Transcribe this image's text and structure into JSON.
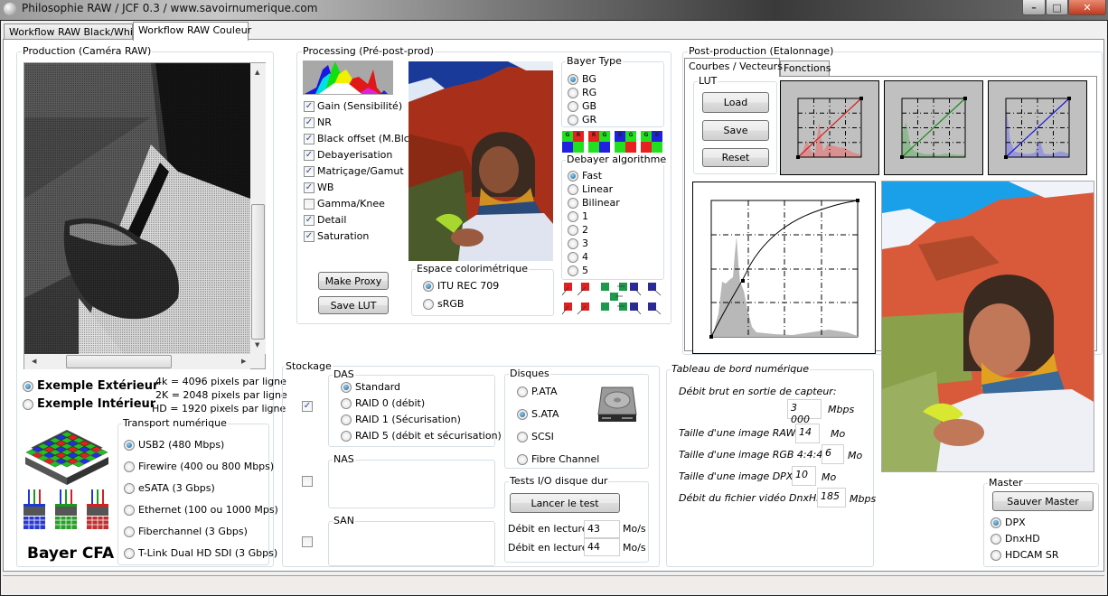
{
  "window": {
    "title": "Philosophie RAW / JCF 0.3 / www.savoirnumerique.com",
    "controls": {
      "minimize": "–",
      "maximize": "□",
      "close": "✕"
    }
  },
  "tabs": [
    {
      "label": "Workflow RAW Black/White",
      "active": false
    },
    {
      "label": "Workflow RAW Couleur",
      "active": true
    }
  ],
  "production": {
    "title": "Production (Caméra RAW)",
    "examples": [
      {
        "label": "Exemple Extérieur",
        "selected": true
      },
      {
        "label": "Exemple Intérieur",
        "selected": false
      }
    ],
    "resolutions": [
      "4k = 4096 pixels par ligne",
      "2K = 2048 pixels par ligne",
      "HD = 1920 pixels par ligne"
    ],
    "bayer_label": "Bayer CFA",
    "transport": {
      "title": "Transport numérique",
      "options": [
        {
          "label": "USB2 (480 Mbps)",
          "selected": true
        },
        {
          "label": "Firewire (400 ou 800 Mbps)",
          "selected": false
        },
        {
          "label": "eSATA (3 Gbps)",
          "selected": false
        },
        {
          "label": "Ethernet (100 ou 1000 Mps)",
          "selected": false
        },
        {
          "label": "Fiberchannel (3 Gbps)",
          "selected": false
        },
        {
          "label": "T-Link Dual HD SDI (3 Gbps)",
          "selected": false
        }
      ]
    }
  },
  "processing": {
    "title": "Processing (Pré-post-prod)",
    "checks": [
      {
        "label": "Gain (Sensibilité)",
        "checked": true
      },
      {
        "label": "NR",
        "checked": true
      },
      {
        "label": "Black offset (M.Blck)",
        "checked": true
      },
      {
        "label": "Debayerisation",
        "checked": true
      },
      {
        "label": "Matriçage/Gamut",
        "checked": true
      },
      {
        "label": "WB",
        "checked": true
      },
      {
        "label": "Gamma/Knee",
        "checked": false
      },
      {
        "label": "Detail",
        "checked": true
      },
      {
        "label": "Saturation",
        "checked": true
      }
    ],
    "make_proxy": "Make Proxy",
    "save_lut": "Save LUT",
    "colorspace": {
      "title": "Espace colorimétrique",
      "options": [
        {
          "label": "ITU REC 709",
          "selected": true
        },
        {
          "label": "sRGB",
          "selected": false
        }
      ]
    },
    "bayer_type": {
      "title": "Bayer Type",
      "options": [
        {
          "label": "BG",
          "selected": true
        },
        {
          "label": "RG",
          "selected": false
        },
        {
          "label": "GB",
          "selected": false
        },
        {
          "label": "GR",
          "selected": false
        }
      ],
      "patterns": [
        [
          "G",
          "R",
          "B",
          "G"
        ],
        [
          "R",
          "G",
          "G",
          "B"
        ],
        [
          "B",
          "G",
          "G",
          "R"
        ],
        [
          "G",
          "B",
          "R",
          "G"
        ]
      ]
    },
    "debayer": {
      "title": "Debayer algorithme",
      "options": [
        {
          "label": "Fast",
          "selected": true
        },
        {
          "label": "Linear",
          "selected": false
        },
        {
          "label": "Bilinear",
          "selected": false
        },
        {
          "label": "1",
          "selected": false
        },
        {
          "label": "2",
          "selected": false
        },
        {
          "label": "3",
          "selected": false
        },
        {
          "label": "4",
          "selected": false
        },
        {
          "label": "5",
          "selected": false
        }
      ]
    }
  },
  "postprod": {
    "title": "Post-production (Etalonnage)",
    "tabs": [
      {
        "label": "Courbes / Vecteurs",
        "active": true
      },
      {
        "label": "Fonctions",
        "active": false
      }
    ],
    "lut": {
      "title": "LUT",
      "load": "Load",
      "save": "Save",
      "reset": "Reset"
    },
    "colors": {
      "red": "#d42020",
      "green": "#1a8a1a",
      "blue": "#1a1ad4"
    }
  },
  "storage": {
    "title": "Stockage",
    "das": {
      "title": "DAS",
      "checked": true,
      "options": [
        {
          "label": "Standard",
          "selected": true
        },
        {
          "label": "RAID 0 (débit)",
          "selected": false
        },
        {
          "label": "RAID 1 (Sécurisation)",
          "selected": false
        },
        {
          "label": "RAID 5 (débit et sécurisation)",
          "selected": false
        }
      ]
    },
    "nas": {
      "title": "NAS",
      "checked": false
    },
    "san": {
      "title": "SAN",
      "checked": false
    },
    "disks": {
      "title": "Disques",
      "options": [
        {
          "label": "P.ATA",
          "selected": false
        },
        {
          "label": "S.ATA",
          "selected": true
        },
        {
          "label": "SCSI",
          "selected": false
        },
        {
          "label": "Fibre Channel",
          "selected": false
        }
      ]
    },
    "io_test": {
      "title": "Tests I/O disque dur",
      "button": "Lancer le test",
      "rows": [
        {
          "label": "Débit en lecture:",
          "value": "43",
          "unit": "Mo/s"
        },
        {
          "label": "Débit en lecture:",
          "value": "44",
          "unit": "Mo/s"
        }
      ]
    }
  },
  "dashboard": {
    "title": "Tableau de bord numérique",
    "sensor_label": "Débit brut en sortie de capteur:",
    "sensor_value": "3 000",
    "sensor_unit": "Mbps",
    "rows": [
      {
        "label": "Taille d'une image RAW:",
        "value": "14",
        "unit": "Mo"
      },
      {
        "label": "Taille d'une image RGB 4:4:4",
        "value": "6",
        "unit": "Mo"
      },
      {
        "label": "Taille d'une image DPX",
        "value": "10",
        "unit": "Mo"
      },
      {
        "label": "Débit du fichier vidéo DnxHD:",
        "value": "185",
        "unit": "Mbps"
      }
    ]
  },
  "master": {
    "title": "Master",
    "button": "Sauver Master",
    "options": [
      {
        "label": "DPX",
        "selected": true
      },
      {
        "label": "DnxHD",
        "selected": false
      },
      {
        "label": "HDCAM SR",
        "selected": false
      }
    ]
  }
}
